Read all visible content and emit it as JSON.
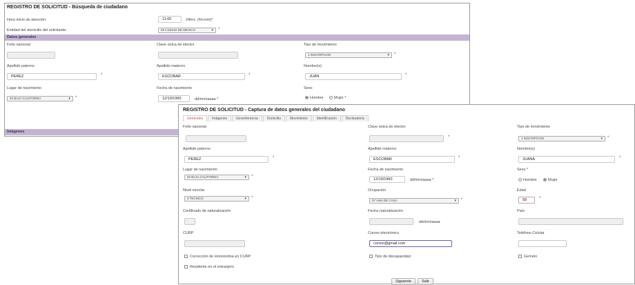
{
  "back": {
    "title": "REGISTRO DE SOLICITUD - Búsqueda de ciudadano",
    "hora_label": "Hora inicio de atención:",
    "hora_value": "11:00",
    "hora_hint": "24hrs. (hh:mm)*",
    "entidad_label": "Entidad del domicilio del solicitante:",
    "entidad_value": "09 CIUDAD DE MEXICO",
    "section_datos": "Datos generales",
    "folio_label": "Folio nacional",
    "clave_label": "Clave única de elector",
    "tipo_label": "Tipo de movimiento",
    "tipo_value": "1 INSCRIPCION",
    "paterno_label": "Apellido paterno",
    "paterno_value": "PEREZ",
    "materno_label": "Apellido materno",
    "materno_value": "ESCOBAR",
    "nombre_label": "Nombre(s)",
    "nombre_value": "JUAN",
    "lugar_label": "Lugar de nacimiento",
    "lugar_value": "02 BAJA CALIFORNIA",
    "fecha_label": "Fecha de nacimiento",
    "fecha_value": "12/10/1960",
    "fecha_hint": "dd/mm/aaaa *",
    "sexo_label": "Sexo",
    "hombre": "Hombre",
    "mujer": "Mujer *",
    "section_imagenes": "Imágenes"
  },
  "front": {
    "title": "REGISTRO DE SOLICITUD - Captura de datos generales del ciudadano",
    "tabs": [
      "Generales",
      "Imágenes",
      "Georeferencia",
      "Domicilio",
      "Movimiento",
      "Identificación",
      "Declaratoria"
    ],
    "folio_label": "Folio nacional",
    "clave_label": "Clave única de elector",
    "tipo_label": "Tipo de movimiento",
    "tipo_value": "1 INSCRIPCION",
    "paterno_label": "Apellido paterno",
    "paterno_value": "PEREZ",
    "materno_label": "Apellido materno",
    "materno_value": "ESCOBAR",
    "nombre_label": "Nombre(s)",
    "nombre_value": "JUANA",
    "lugar_label": "Lugar de nacimiento",
    "lugar_value": "02 BAJA CALIFORNIA",
    "fecha_label": "Fecha de nacimiento",
    "fecha_value": "12/10/1960",
    "fecha_hint": "dd/mm/aaaa *",
    "sexo_label": "Sexo *",
    "hombre": "Hombre",
    "mujer": "Mujer",
    "nivel_label": "Nivel escolar",
    "nivel_value": "6 TECNICO",
    "ocupacion_label": "Ocupación",
    "ocupacion_value": "07 AMA DE CASA",
    "edad_label": "Edad",
    "edad_value": "58",
    "cert_label": "Certificado de naturalización",
    "fecha_nat_label": "Fecha naturalización",
    "fecha_nat_hint": "dd/mm/aaaa",
    "pais_label": "País",
    "curp_label": "CURP",
    "correo_label": "Correo electrónico",
    "correo_value": "correo@gmail.com",
    "tel_label": "Teléfono Celular",
    "correccion_label": "Corrección de Homonimia en CURP",
    "discap_label": "Tipo de discapacidad",
    "gemelo_label": "Gemelo",
    "residente_label": "Residente en el extranjero",
    "siguiente": "Siguiente",
    "salir": "Salir"
  },
  "colors": {
    "section_bar": "#c4b4d2",
    "active_tab_text": "#c0504d",
    "focus_border": "#6a5fa8"
  },
  "icons": {
    "dropdown": "chevron-down-icon"
  }
}
